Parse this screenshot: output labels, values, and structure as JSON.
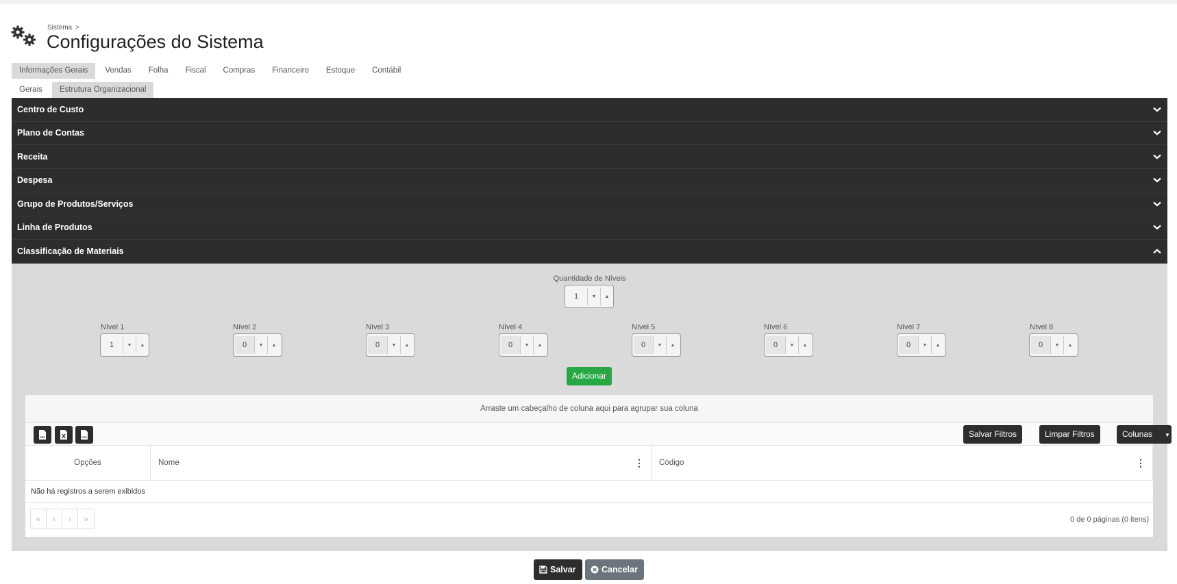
{
  "breadcrumb": {
    "parent": "Sistema",
    "separator": ">"
  },
  "page_title": "Configurações do Sistema",
  "tabs": [
    {
      "label": "Informações Gerais",
      "active": true
    },
    {
      "label": "Vendas"
    },
    {
      "label": "Folha"
    },
    {
      "label": "Fiscal"
    },
    {
      "label": "Compras"
    },
    {
      "label": "Financeiro"
    },
    {
      "label": "Estoque"
    },
    {
      "label": "Contábil"
    }
  ],
  "subtabs": [
    {
      "label": "Gerais"
    },
    {
      "label": "Estrutura Organizacional",
      "active": true
    }
  ],
  "accordion": [
    {
      "label": "Centro de Custo",
      "icon": "chevron-down-icon"
    },
    {
      "label": "Plano de Contas",
      "icon": "chevron-down-icon"
    },
    {
      "label": "Receita",
      "icon": "chevron-down-icon"
    },
    {
      "label": "Despesa",
      "icon": "chevron-down-icon"
    },
    {
      "label": "Grupo de Produtos/Serviços",
      "icon": "chevron-down-icon"
    },
    {
      "label": "Linha de Produtos",
      "icon": "chevron-down-icon"
    },
    {
      "label": "Classificação de Materiais",
      "icon": "chevron-up-icon",
      "expanded": true
    }
  ],
  "classificacao": {
    "quantity_label": "Quantidade de Níveis",
    "quantity_value": "1",
    "levels": [
      {
        "label": "Nível 1",
        "value": "1"
      },
      {
        "label": "Nível 2",
        "value": "0"
      },
      {
        "label": "Nível 3",
        "value": "0"
      },
      {
        "label": "Nível 4",
        "value": "0"
      },
      {
        "label": "Nível 5",
        "value": "0"
      },
      {
        "label": "Nível 6",
        "value": "0"
      },
      {
        "label": "Nível 7",
        "value": "0"
      },
      {
        "label": "Nível 8",
        "value": "0"
      }
    ],
    "add_label": "Adicionar"
  },
  "grid": {
    "group_hint": "Arraste um cabeçalho de coluna aqui para agrupar sua coluna",
    "export_icons": [
      "pdf-export-icon",
      "excel-export-icon",
      "csv-export-icon"
    ],
    "save_filters": "Salvar Filtros",
    "clear_filters": "Limpar Filtros",
    "columns_button": "Colunas",
    "columns": [
      "Opções",
      "Nome",
      "Código"
    ],
    "empty_message": "Não há registros a serem exibidos",
    "pager_buttons": [
      "«",
      "‹",
      "›",
      "»"
    ],
    "pager_info": "0 de 0 páginas (0 itens)"
  },
  "footer": {
    "save": "Salvar",
    "cancel": "Cancelar"
  },
  "colors": {
    "accordion_bg": "#2d2d2d",
    "panel_bg": "#dadada",
    "add_button": "#28a745",
    "cancel_button": "#6c757d"
  }
}
